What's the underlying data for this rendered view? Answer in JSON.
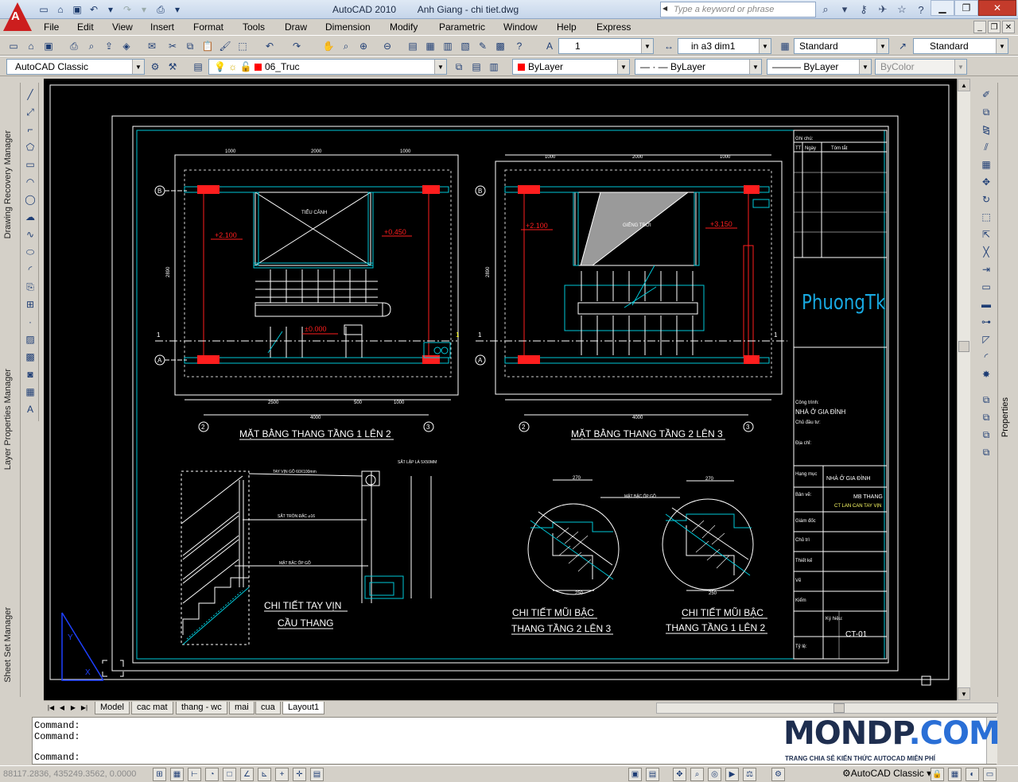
{
  "titlebar": {
    "app_name": "AutoCAD 2010",
    "document_title": "Anh Giang - chi tiet.dwg",
    "search_placeholder": "Type a keyword or phrase"
  },
  "menu": [
    "File",
    "Edit",
    "View",
    "Insert",
    "Format",
    "Tools",
    "Draw",
    "Dimension",
    "Modify",
    "Parametric",
    "Window",
    "Help",
    "Express"
  ],
  "styles_toolbar": {
    "text_style_value": "1",
    "dim_style_value": "in a3 dim1",
    "table_style_value": "Standard",
    "multileader_style_value": "Standard"
  },
  "layers_toolbar": {
    "workspace_value": "AutoCAD Classic",
    "layer_value": "06_Truc",
    "color_value": "ByLayer",
    "linetype_value": "ByLayer",
    "lineweight_value": "ByLayer",
    "plotstyle_value": "ByColor",
    "layer_color": "#ff0000"
  },
  "palettes": {
    "drawing_recovery": "Drawing Recovery Manager",
    "layer_properties": "Layer Properties Manager",
    "sheet_set": "Sheet Set Manager",
    "properties": "Properties"
  },
  "drawing": {
    "plan1_title": "MẶT BẰNG THANG TẦNG 1 LÊN 2",
    "plan2_title": "MẶT BẰNG THANG TẦNG 2 LÊN 3",
    "detail1_title_line1": "CHI TIẾT TAY VỊN",
    "detail1_title_line2": "CẦU THANG",
    "detail2_title_line1": "CHI TIẾT MŨI BẬC",
    "detail2_title_line2": "THANG TẦNG 2 LÊN 3",
    "detail3_title_line1": "CHI TIẾT MŨI BẬC",
    "detail3_title_line2": "THANG TẦNG 1 LÊN 2",
    "plan1_dims": {
      "top_1": "1000",
      "top_2": "2000",
      "top_3": "1000",
      "bottom_1": "2500",
      "bottom_2": "500",
      "bottom_3": "1000",
      "total": "4000",
      "left": "2890"
    },
    "plan2_dims": {
      "top_1": "1000",
      "top_2": "2000",
      "top_3": "1000",
      "total": "4000",
      "left": "2890"
    },
    "plan1_levels": {
      "left": "+2.100",
      "right": "+0.450",
      "center": "±0.000"
    },
    "plan2_levels": {
      "left": "+2.100",
      "right": "+3.150"
    },
    "plan1_labels": {
      "well": "TIỂU CẢNH"
    },
    "plan2_labels": {
      "well": "GIẾNG TRỜI"
    },
    "axis_labels": {
      "b": "B",
      "a": "A",
      "two": "2",
      "three": "3",
      "one": "1"
    },
    "rail_labels": {
      "handrail": "TAY VỊN GỖ 60X100mm",
      "bar": "SẮT TRÒN ĐẶC ⌀16",
      "tread": "MẶT BẬC ỐP GỖ",
      "plate": "SẮT LẬP LÀ 5X50MM"
    },
    "nosing_labels": {
      "tread": "MẶT BẬC ỐP GỖ",
      "dim_top": "270",
      "dim_bottom": "250",
      "dim_top_b": "270",
      "dim_bottom_b": "250"
    },
    "titleblock": {
      "notes_header": "Ghi chú:",
      "col_tt": "TT",
      "col_date": "Ngày",
      "col_summary": "Tóm tắt",
      "logo_text": "PhuongTk",
      "project_label": "Công trình:",
      "project_value": "NHÀ Ở GIA ĐÌNH",
      "investor_label": "Chủ đầu tư:",
      "address_label": "Địa chỉ:",
      "item_label": "Hạng mục",
      "item_value": "NHÀ Ở GIA ĐÌNH",
      "drawing_label": "Bản vẽ:",
      "drawing_value_1": "MB THANG",
      "drawing_value_2": "CT LAN CAN TAY VỊN",
      "director_label": "Giám đốc",
      "chairman_label": "Chủ trì",
      "designer_label": "Thiết kế",
      "drafter_label": "Vẽ",
      "checker_label": "Kiểm",
      "code_label": "Ký hiệu:",
      "code_value": "CT-01",
      "scale_label": "Tỷ lệ:"
    }
  },
  "layout_tabs": [
    "Model",
    "cac mat",
    "thang - wc",
    "mai",
    "cua",
    "Layout1"
  ],
  "active_tab": "Layout1",
  "command_lines": [
    "Command:",
    "Command:",
    "Command:"
  ],
  "watermark": {
    "main": "MONDP",
    "suffix": ".COM",
    "tagline": "TRANG CHIA SẺ KIẾN THỨC AUTOCAD MIỄN PHÍ"
  },
  "status": {
    "coordinates": "88117.2836, 435249.3562, 0.0000",
    "workspace": "AutoCAD Classic"
  },
  "colors": {
    "cyan": "#00c8d8",
    "red": "#ff1e1e",
    "white": "#ffffff",
    "logo_blue": "#18a8e0",
    "background": "#000000"
  }
}
